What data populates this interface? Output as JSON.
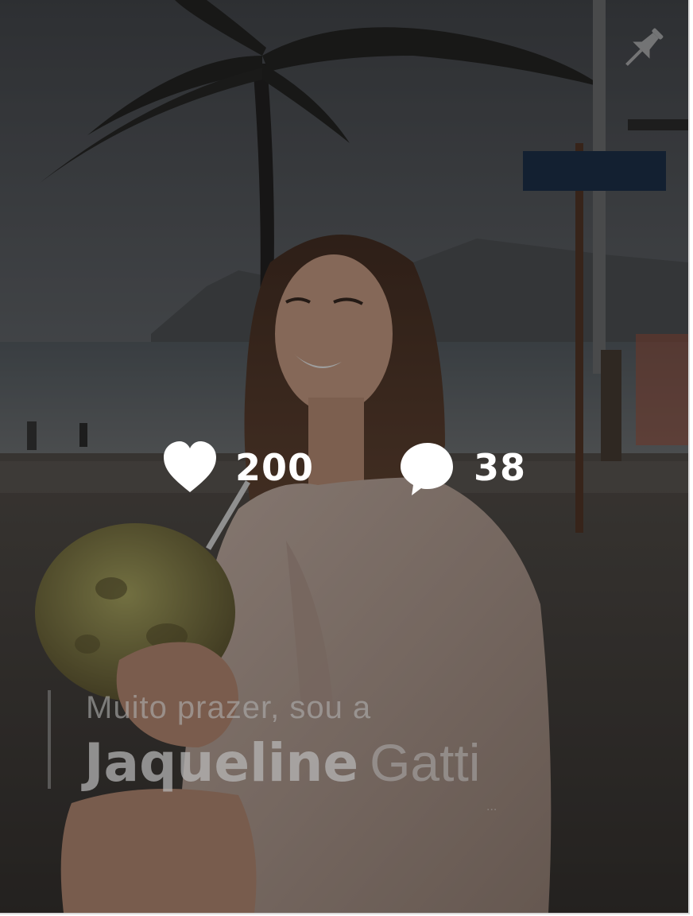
{
  "post": {
    "pin_icon": "pin-icon",
    "likes": {
      "icon": "heart-icon",
      "count": "200"
    },
    "comments": {
      "icon": "speech-bubble-icon",
      "count": "38"
    },
    "caption": {
      "greeting": "Muito prazer, sou a",
      "first_name": "Jaqueline",
      "last_name": "Gatti",
      "subtitle": "...",
      "text_color": "#ffffff"
    }
  }
}
